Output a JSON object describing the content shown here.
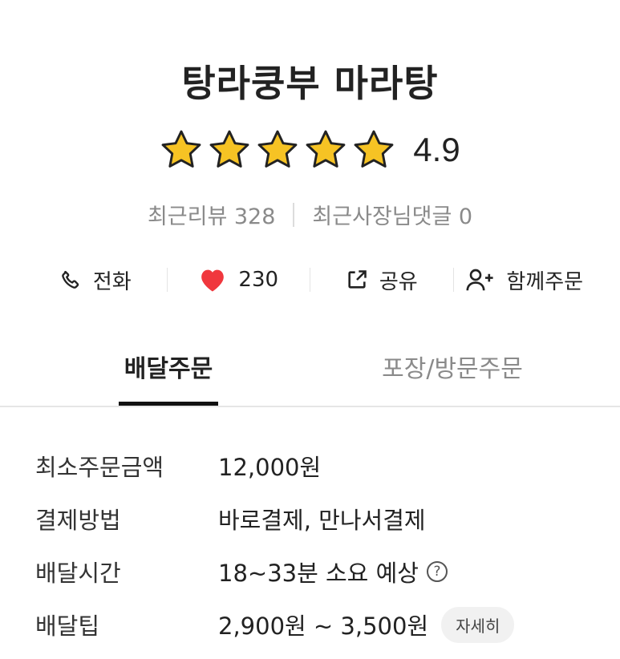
{
  "store": {
    "name": "탕라쿵부 마라탕",
    "rating": "4.9",
    "rating_stars": 5
  },
  "reviews": {
    "recent_reviews": "최근리뷰 328",
    "owner_replies": "최근사장님댓글 0"
  },
  "actions": {
    "call": "전화",
    "likes": "230",
    "share": "공유",
    "group_order": "함께주문"
  },
  "tabs": {
    "delivery": "배달주문",
    "pickup": "포장/방문주문"
  },
  "info": {
    "min_order_label": "최소주문금액",
    "min_order_value": "12,000원",
    "payment_label": "결제방법",
    "payment_value": "바로결제, 만나서결제",
    "time_label": "배달시간",
    "time_value": "18~33분 소요 예상",
    "tip_label": "배달팁",
    "tip_value": "2,900원 ~ 3,500원",
    "detail_button": "자세히",
    "help_glyph": "?"
  },
  "colors": {
    "star": "#f6c324",
    "heart": "#f0373d",
    "active_tab": "#111111",
    "muted_text": "#8a8a8a"
  }
}
